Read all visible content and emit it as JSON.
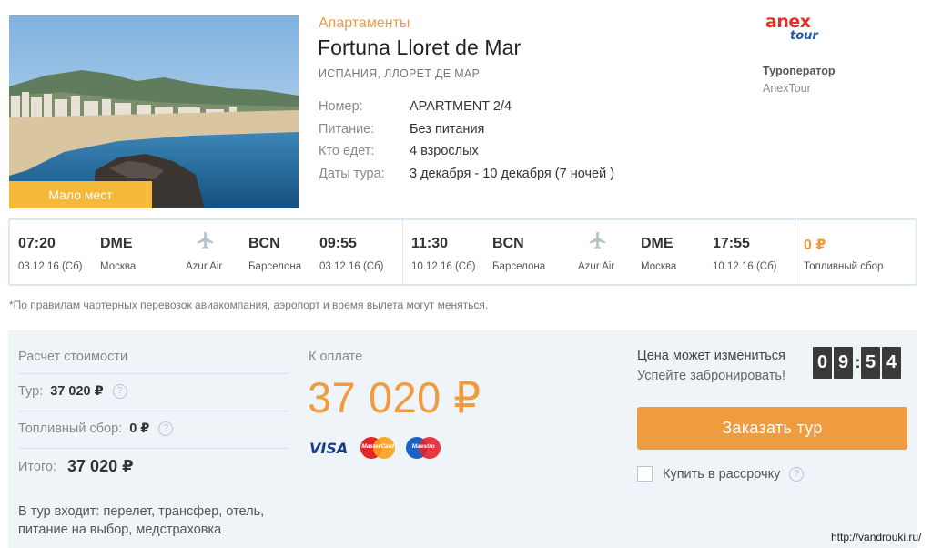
{
  "hotel": {
    "badge": "Мало мест",
    "type": "Апартаменты",
    "name": "Fortuna Lloret de Mar",
    "location": "ИСПАНИЯ, ЛЛОРЕТ ДЕ МАР",
    "details": [
      {
        "key": "Номер:",
        "value": "APARTMENT 2/4"
      },
      {
        "key": "Питание:",
        "value": "Без питания"
      },
      {
        "key": "Кто едет:",
        "value": "4 взрослых"
      },
      {
        "key": "Даты тура:",
        "value": "3 декабря - 10 декабря (7 ночей )"
      }
    ]
  },
  "operator": {
    "logo_top": "anex",
    "logo_bottom": "tour",
    "title": "Туроператор",
    "name": "AnexTour"
  },
  "flights": {
    "outbound": {
      "dep_time": "07:20",
      "dep_date": "03.12.16 (Сб)",
      "dep_code": "DME",
      "dep_city": "Москва",
      "airline": "Azur Air",
      "arr_code": "BCN",
      "arr_city": "Барселона",
      "arr_time": "09:55",
      "arr_date": "03.12.16 (Сб)"
    },
    "return": {
      "dep_time": "11:30",
      "dep_date": "10.12.16 (Сб)",
      "dep_code": "BCN",
      "dep_city": "Барселона",
      "airline": "Azur Air",
      "arr_code": "DME",
      "arr_city": "Москва",
      "arr_time": "17:55",
      "arr_date": "10.12.16 (Сб)"
    },
    "fuel_value": "0 ₽",
    "fuel_label": "Топливный сбор"
  },
  "disclaimer": "*По правилам чартерных перевозок авиакомпания, аэропорт и время вылета могут меняться.",
  "cost": {
    "title": "Расчет стоимости",
    "tour_label": "Тур:",
    "tour_value": "37 020 ₽",
    "fuel_label": "Топливный сбор:",
    "fuel_value": "0 ₽",
    "total_label": "Итого:",
    "total_value": "37 020 ₽",
    "includes": "В тур входит: перелет, трансфер, отель, питание на выбор, медстраховка"
  },
  "payment": {
    "title": "К оплате",
    "amount": "37 020 ₽",
    "cards": {
      "visa": "VISA",
      "mastercard": "MasterCard",
      "maestro": "Maestro"
    }
  },
  "booking": {
    "price_note": "Цена может измениться",
    "hurry": "Успейте забронировать!",
    "timer": [
      "0",
      "9",
      "5",
      "4"
    ],
    "order_button": "Заказать тур",
    "installment_label": "Купить в рассрочку"
  },
  "watermark": "http://vandrouki.ru/",
  "colors": {
    "accent": "#ef9b3f",
    "badge": "#f5b839",
    "panel": "#eef4f7",
    "border": "#dde8ee"
  }
}
